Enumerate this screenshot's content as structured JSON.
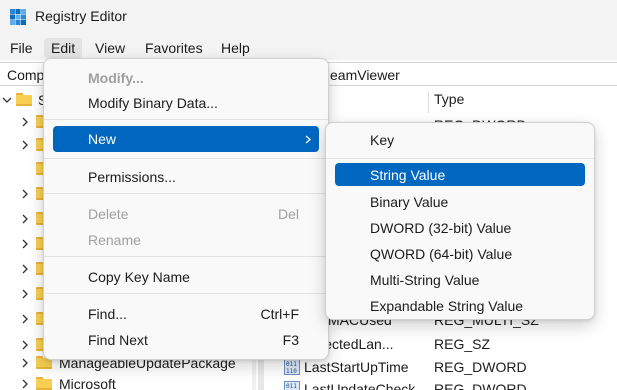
{
  "window": {
    "title": "Registry Editor"
  },
  "menubar": {
    "items": [
      {
        "label": "File"
      },
      {
        "label": "Edit"
      },
      {
        "label": "View"
      },
      {
        "label": "Favorites"
      },
      {
        "label": "Help"
      }
    ]
  },
  "address": {
    "start": "Comp",
    "end": "eamViewer"
  },
  "tree": {
    "top_label": "S",
    "items": [
      {
        "label": "ManageableUpdatePackage"
      },
      {
        "label": "Microsoft"
      }
    ]
  },
  "list": {
    "header_type": "Type",
    "rows": [
      {
        "name": "",
        "type": "REG_DWORD"
      },
      {
        "name": "MACUsed",
        "type": "REG_MULTI_SZ"
      },
      {
        "name": "SelectedLan...",
        "type": "REG_SZ"
      },
      {
        "name": "LastStartUpTime",
        "type": "REG_DWORD"
      },
      {
        "name": "LastUpdateCheck",
        "type": "REG_DWORD"
      }
    ]
  },
  "edit_menu": {
    "items": [
      {
        "label": "Modify...",
        "accel": ""
      },
      {
        "label": "Modify Binary Data...",
        "accel": ""
      },
      {
        "label": "New",
        "accel": ""
      },
      {
        "label": "Permissions...",
        "accel": ""
      },
      {
        "label": "Delete",
        "accel": "Del"
      },
      {
        "label": "Rename",
        "accel": ""
      },
      {
        "label": "Copy Key Name",
        "accel": ""
      },
      {
        "label": "Find...",
        "accel": "Ctrl+F"
      },
      {
        "label": "Find Next",
        "accel": "F3"
      }
    ]
  },
  "new_submenu": {
    "items": [
      {
        "label": "Key"
      },
      {
        "label": "String Value"
      },
      {
        "label": "Binary Value"
      },
      {
        "label": "DWORD (32-bit) Value"
      },
      {
        "label": "QWORD (64-bit) Value"
      },
      {
        "label": "Multi-String Value"
      },
      {
        "label": "Expandable String Value"
      }
    ]
  },
  "colors": {
    "accent": "#0067c0",
    "folder": "#f8cf52",
    "disabled_text": "#a0a0a0"
  },
  "icons": [
    "registry-editor-icon",
    "folder-icon",
    "chevron-right-icon",
    "chevron-down-icon",
    "reg-binary-value-icon",
    "submenu-arrow-icon"
  ]
}
